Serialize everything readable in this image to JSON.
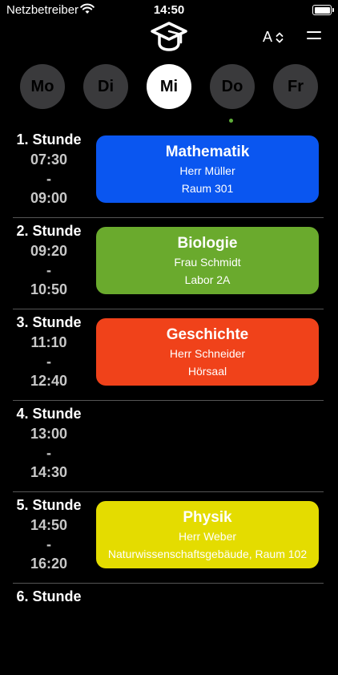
{
  "status_bar": {
    "carrier": "Netzbetreiber",
    "time": "14:50",
    "battery_level": 1.0
  },
  "header": {
    "sort_label": "A"
  },
  "days": {
    "items": [
      {
        "label": "Mo"
      },
      {
        "label": "Di"
      },
      {
        "label": "Mi"
      },
      {
        "label": "Do"
      },
      {
        "label": "Fr"
      }
    ],
    "selected": "Mi"
  },
  "periods": [
    {
      "label": "1. Stunde",
      "start": "07:30",
      "sep": "-",
      "end": "09:00",
      "lesson": {
        "subject": "Mathematik",
        "teacher": "Herr Müller",
        "room": "Raum 301",
        "color": "#0a56f0"
      }
    },
    {
      "label": "2. Stunde",
      "start": "09:20",
      "sep": "-",
      "end": "10:50",
      "lesson": {
        "subject": "Biologie",
        "teacher": "Frau Schmidt",
        "room": "Labor 2A",
        "color": "#6aaa2d"
      }
    },
    {
      "label": "3. Stunde",
      "start": "11:10",
      "sep": "-",
      "end": "12:40",
      "lesson": {
        "subject": "Geschichte",
        "teacher": "Herr Schneider",
        "room": "Hörsaal",
        "color": "#f0421a"
      }
    },
    {
      "label": "4. Stunde",
      "start": "13:00",
      "sep": "-",
      "end": "14:30"
    },
    {
      "label": "5. Stunde",
      "start": "14:50",
      "sep": "-",
      "end": "16:20",
      "lesson": {
        "subject": "Physik",
        "teacher": "Herr Weber",
        "room": "Naturwissenschaftsgebäude, Raum 102",
        "color": "#e4dc00"
      }
    },
    {
      "label": "6. Stunde"
    }
  ]
}
